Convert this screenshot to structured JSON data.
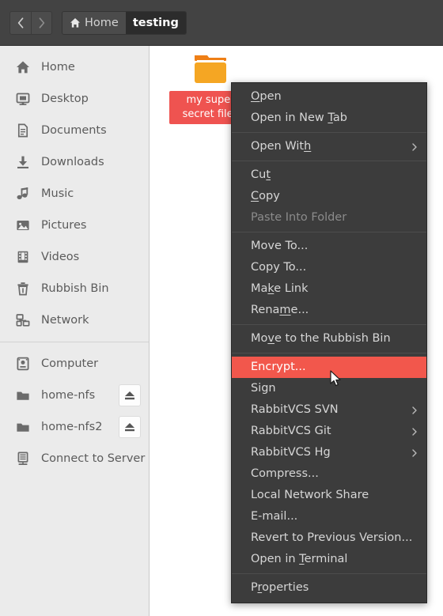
{
  "header": {
    "back_label": "Back",
    "forward_label": "Forward",
    "back_icon": "chevron-left-icon",
    "forward_icon": "chevron-right-icon",
    "breadcrumbs": [
      {
        "label": "Home",
        "icon": "home-icon",
        "active": false
      },
      {
        "label": "testing",
        "icon": "",
        "active": true
      }
    ]
  },
  "sidebar": {
    "groups": [
      {
        "items": [
          {
            "label": "Home",
            "icon": "home-icon",
            "eject": false
          },
          {
            "label": "Desktop",
            "icon": "desktop-icon",
            "eject": false
          },
          {
            "label": "Documents",
            "icon": "document-icon",
            "eject": false
          },
          {
            "label": "Downloads",
            "icon": "download-icon",
            "eject": false
          },
          {
            "label": "Music",
            "icon": "music-icon",
            "eject": false
          },
          {
            "label": "Pictures",
            "icon": "picture-icon",
            "eject": false
          },
          {
            "label": "Videos",
            "icon": "video-icon",
            "eject": false
          },
          {
            "label": "Rubbish Bin",
            "icon": "trash-icon",
            "eject": false
          },
          {
            "label": "Network",
            "icon": "network-icon",
            "eject": false
          }
        ]
      },
      {
        "items": [
          {
            "label": "Computer",
            "icon": "computer-icon",
            "eject": false
          },
          {
            "label": "home-nfs",
            "icon": "folder-icon",
            "eject": true,
            "eject_icon": "eject-icon"
          },
          {
            "label": "home-nfs2",
            "icon": "folder-icon",
            "eject": true,
            "eject_icon": "eject-icon"
          },
          {
            "label": "Connect to Server",
            "icon": "server-icon",
            "eject": false
          }
        ]
      }
    ]
  },
  "fileview": {
    "items": [
      {
        "name": "my super secret files",
        "icon": "folder-icon",
        "selected": true
      }
    ]
  },
  "context_menu": {
    "sections": [
      {
        "items": [
          {
            "label": "Open",
            "mnemonic": "O",
            "state": "normal",
            "submenu": false
          },
          {
            "label": "Open in New Tab",
            "mnemonic": "T",
            "state": "normal",
            "submenu": false
          }
        ]
      },
      {
        "items": [
          {
            "label": "Open With",
            "mnemonic": "h",
            "state": "normal",
            "submenu": true
          }
        ]
      },
      {
        "items": [
          {
            "label": "Cut",
            "mnemonic": "t",
            "state": "normal",
            "submenu": false
          },
          {
            "label": "Copy",
            "mnemonic": "C",
            "state": "normal",
            "submenu": false
          },
          {
            "label": "Paste Into Folder",
            "mnemonic": "",
            "state": "disabled",
            "submenu": false
          }
        ]
      },
      {
        "items": [
          {
            "label": "Move To...",
            "mnemonic": "",
            "state": "normal",
            "submenu": false
          },
          {
            "label": "Copy To...",
            "mnemonic": "",
            "state": "normal",
            "submenu": false
          },
          {
            "label": "Make Link",
            "mnemonic": "k",
            "state": "normal",
            "submenu": false
          },
          {
            "label": "Rename...",
            "mnemonic": "m",
            "state": "normal",
            "submenu": false
          }
        ]
      },
      {
        "items": [
          {
            "label": "Move to the Rubbish Bin",
            "mnemonic": "v",
            "state": "normal",
            "submenu": false
          }
        ]
      },
      {
        "items": [
          {
            "label": "Encrypt...",
            "mnemonic": "",
            "state": "selected",
            "submenu": false
          },
          {
            "label": "Sign",
            "mnemonic": "",
            "state": "normal",
            "submenu": false
          },
          {
            "label": "RabbitVCS SVN",
            "mnemonic": "",
            "state": "normal",
            "submenu": true
          },
          {
            "label": "RabbitVCS Git",
            "mnemonic": "",
            "state": "normal",
            "submenu": true
          },
          {
            "label": "RabbitVCS Hg",
            "mnemonic": "",
            "state": "normal",
            "submenu": true
          },
          {
            "label": "Compress...",
            "mnemonic": "",
            "state": "normal",
            "submenu": false
          },
          {
            "label": "Local Network Share",
            "mnemonic": "",
            "state": "normal",
            "submenu": false
          },
          {
            "label": "E-mail...",
            "mnemonic": "",
            "state": "normal",
            "submenu": false
          },
          {
            "label": "Revert to Previous Version...",
            "mnemonic": "",
            "state": "normal",
            "submenu": false
          },
          {
            "label": "Open in Terminal",
            "mnemonic": "T",
            "state": "normal",
            "submenu": false
          }
        ]
      },
      {
        "items": [
          {
            "label": "Properties",
            "mnemonic": "r",
            "state": "normal",
            "submenu": false
          }
        ]
      }
    ]
  },
  "cursor": {
    "icon": "mouse-pointer-icon"
  },
  "colors": {
    "header_bg": "#434343",
    "sidebar_bg": "#ebebeb",
    "menu_bg": "#3c3c3c",
    "menu_text": "#d6d6d6",
    "menu_disabled": "#8b8b8b",
    "highlight": "#f2574c",
    "selection_red": "#ef5350",
    "folder_orange": "#f5a623",
    "folder_tab": "#ef7f16"
  }
}
